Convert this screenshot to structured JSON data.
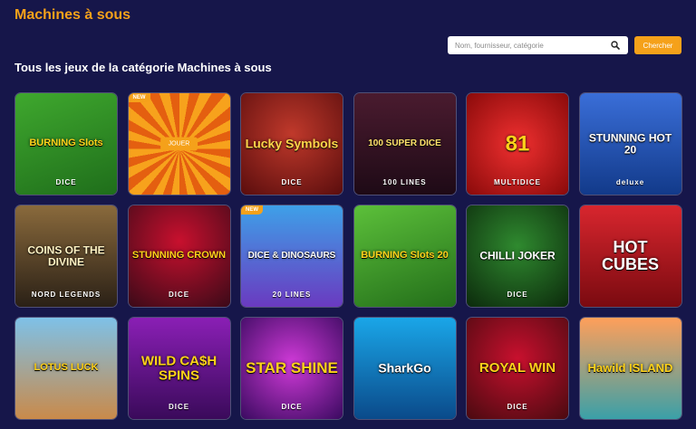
{
  "header": {
    "title": "Machines à sous",
    "search_placeholder": "Nom, fournisseur, catégorie",
    "search_button": "Chercher"
  },
  "section": {
    "heading": "Tous les jeux de la catégorie Machines à sous"
  },
  "games": [
    {
      "name": "game-burning-slots-dice",
      "title": "BURNING Slots",
      "sub": "DICE",
      "bg": "linear-gradient(160deg,#3fa82e,#1f6e1b)",
      "title_color": "#ffd21a",
      "size": 11
    },
    {
      "name": "game-new-orange",
      "title": "",
      "sub": "",
      "bg": "repeating-conic-gradient(from 0deg at 50% 55%, #f7a21c 0deg 10deg, #e45f10 10deg 20deg)",
      "title_color": "#fff",
      "size": 10,
      "badge": "NEW",
      "play": "JOUER"
    },
    {
      "name": "game-lucky-symbols-dice",
      "title": "Lucky Symbols",
      "sub": "DICE",
      "bg": "radial-gradient(circle at 50% 40%,#c0392b,#5a0d0d)",
      "title_color": "#ffd54a",
      "size": 14
    },
    {
      "name": "game-100-super-dice",
      "title": "100 SUPER DICE",
      "sub": "100 LINES",
      "bg": "linear-gradient(180deg,#4a1b2f,#1e0a16)",
      "title_color": "#ffe36b",
      "size": 10
    },
    {
      "name": "game-multidice-81",
      "title": "81",
      "sub": "MULTIDICE",
      "bg": "radial-gradient(circle at 50% 50%,#f03030,#8a0a0a)",
      "title_color": "#ffd21a",
      "size": 24
    },
    {
      "name": "game-stunning-hot-20-deluxe",
      "title": "STUNNING HOT 20",
      "sub": "deluxe",
      "bg": "linear-gradient(180deg,#3a6ed8,#123a8a)",
      "title_color": "#fff",
      "size": 12
    },
    {
      "name": "game-coins-of-the-divine",
      "title": "COINS OF THE DIVINE",
      "sub": "NORD LEGENDS",
      "bg": "linear-gradient(180deg,#8a6a3c,#2a2016)",
      "title_color": "#fff3c4",
      "size": 12
    },
    {
      "name": "game-stunning-crown-dice",
      "title": "STUNNING CROWN",
      "sub": "DICE",
      "bg": "radial-gradient(circle at 50% 35%,#c8102e,#3a0a18)",
      "title_color": "#ffd21a",
      "size": 11
    },
    {
      "name": "game-dice-and-dinosaurs",
      "title": "DICE & DINOSAURS",
      "sub": "20 LINES",
      "bg": "linear-gradient(180deg,#3ea0e8,#6a3ac0)",
      "title_color": "#fff",
      "size": 10,
      "badge": "NEW"
    },
    {
      "name": "game-burning-slots-20",
      "title": "BURNING Slots 20",
      "sub": "",
      "bg": "linear-gradient(160deg,#5cc03a,#236e1a)",
      "title_color": "#ffd21a",
      "size": 11
    },
    {
      "name": "game-chilli-joker-dice",
      "title": "CHILLI JOKER",
      "sub": "DICE",
      "bg": "radial-gradient(circle at 50% 40%,#2f8a2f,#0c2a0c)",
      "title_color": "#fff",
      "size": 12
    },
    {
      "name": "game-hot-cubes",
      "title": "HOT CUBES",
      "sub": "",
      "bg": "linear-gradient(180deg,#d8262e,#7a0a10)",
      "title_color": "#fff",
      "size": 18
    },
    {
      "name": "game-lotus-luck",
      "title": "LOTUS LUCK",
      "sub": "",
      "bg": "linear-gradient(180deg,#7ec1e8,#c98a4a)",
      "title_color": "#ffd21a",
      "size": 11
    },
    {
      "name": "game-wild-cash-spins-dice",
      "title": "WILD CA$H SPINS",
      "sub": "DICE",
      "bg": "linear-gradient(180deg,#8a1fb5,#3a0a5a)",
      "title_color": "#ffd21a",
      "size": 15
    },
    {
      "name": "game-star-shine-dice",
      "title": "STAR SHINE",
      "sub": "DICE",
      "bg": "radial-gradient(circle at 50% 45%,#d03ad8,#3a0a60)",
      "title_color": "#ffd21a",
      "size": 17
    },
    {
      "name": "game-shark-go",
      "title": "SharkGo",
      "sub": "",
      "bg": "linear-gradient(180deg,#1aa6e8,#0a4a8a)",
      "title_color": "#fff",
      "size": 14
    },
    {
      "name": "game-royal-win-dice",
      "title": "ROYAL WIN",
      "sub": "DICE",
      "bg": "radial-gradient(circle at 50% 40%,#c8102e,#4a0a10)",
      "title_color": "#ffd21a",
      "size": 15
    },
    {
      "name": "game-hawild-island",
      "title": "Hawild ISLAND",
      "sub": "",
      "bg": "linear-gradient(180deg,#ff9f5a,#3aa0a8)",
      "title_color": "#ffd21a",
      "size": 13
    }
  ],
  "colors": {
    "background": "#16164a",
    "accent": "#f5a11a"
  }
}
